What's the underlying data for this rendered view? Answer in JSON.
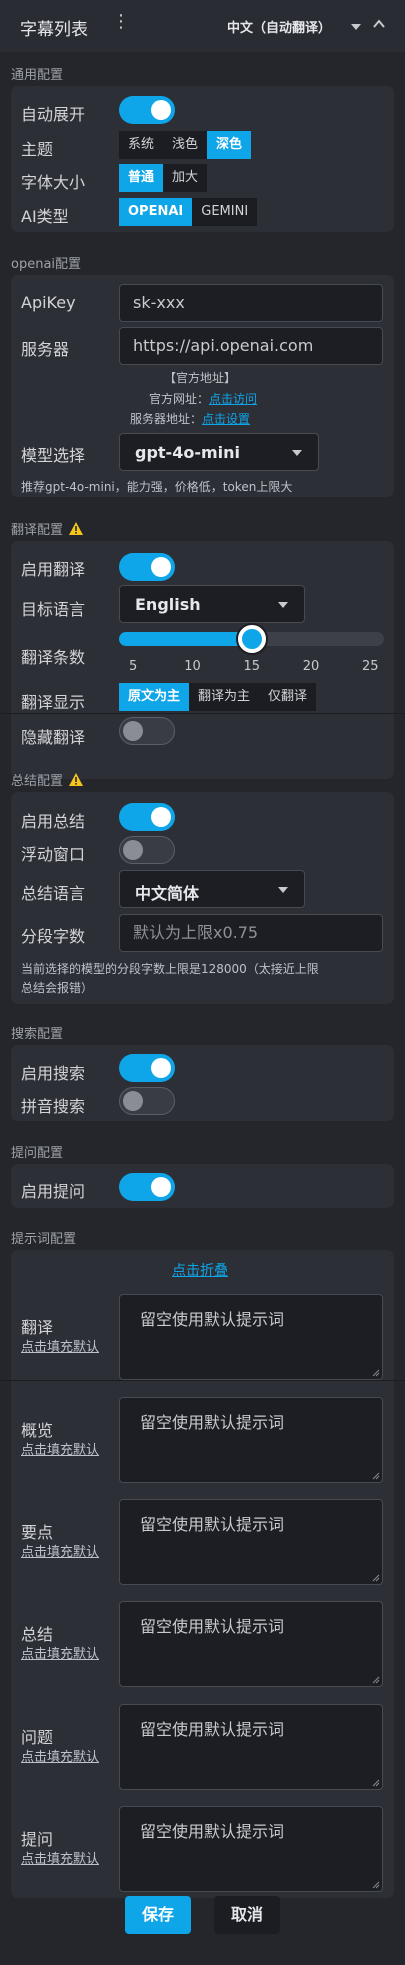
{
  "header": {
    "title": "字幕列表",
    "language": "中文（自动翻译）"
  },
  "general": {
    "section_title": "通用配置",
    "auto_expand_label": "自动展开",
    "auto_expand": true,
    "theme_label": "主题",
    "theme_options": [
      "系统",
      "浅色",
      "深色"
    ],
    "theme_selected": "深色",
    "font_size_label": "字体大小",
    "font_size_options": [
      "普通",
      "加大"
    ],
    "font_size_selected": "普通",
    "ai_type_label": "AI类型",
    "ai_type_options": [
      "OPENAI",
      "GEMINI"
    ],
    "ai_type_selected": "OPENAI"
  },
  "openai": {
    "section_title": "openai配置",
    "apikey_label": "ApiKey",
    "apikey_value": "sk-xxx",
    "server_label": "服务器",
    "server_value": "https://api.openai.com",
    "official_title": "【官方地址】",
    "official_site_prefix": "官方网址：",
    "official_site_link": "点击访问",
    "server_addr_prefix": "服务器地址：",
    "server_addr_link": "点击设置",
    "model_label": "模型选择",
    "model_value": "gpt-4o-mini",
    "model_hint": "推荐gpt-4o-mini，能力强，价格低，token上限大"
  },
  "translate": {
    "section_title": "翻译配置",
    "enable_label": "启用翻译",
    "enable": true,
    "target_lang_label": "目标语言",
    "target_lang_value": "English",
    "count_label": "翻译条数",
    "count_value": 15,
    "count_min": 5,
    "count_max": 25,
    "count_ticks": [
      "5",
      "10",
      "15",
      "20",
      "25"
    ],
    "display_label": "翻译显示",
    "display_options": [
      "原文为主",
      "翻译为主",
      "仅翻译"
    ],
    "display_selected": "原文为主",
    "hide_label": "隐藏翻译",
    "hide": false
  },
  "summary": {
    "section_title": "总结配置",
    "enable_label": "启用总结",
    "enable": true,
    "float_label": "浮动窗口",
    "float": false,
    "lang_label": "总结语言",
    "lang_value": "中文简体",
    "segment_label": "分段字数",
    "segment_placeholder": "默认为上限x0.75",
    "segment_hint_1": "当前选择的模型的分段字数上限是128000（太接近上限",
    "segment_hint_2": "总结会报错）"
  },
  "search": {
    "section_title": "搜索配置",
    "enable_label": "启用搜索",
    "enable": true,
    "pinyin_label": "拼音搜索",
    "pinyin": false
  },
  "ask": {
    "section_title": "提问配置",
    "enable_label": "启用提问",
    "enable": true
  },
  "prompts": {
    "section_title": "提示词配置",
    "collapse_link": "点击折叠",
    "fill_default": "点击填充默认",
    "placeholder": "留空使用默认提示词",
    "items": [
      {
        "label": "翻译"
      },
      {
        "label": "概览"
      },
      {
        "label": "要点"
      },
      {
        "label": "总结"
      },
      {
        "label": "问题"
      },
      {
        "label": "提问"
      }
    ]
  },
  "footer": {
    "save_label": "保存",
    "cancel_label": "取消"
  },
  "colors": {
    "accent": "#0ea5e9",
    "background": "#24262c",
    "card": "#2d2f37",
    "warning": "#f5c518"
  }
}
